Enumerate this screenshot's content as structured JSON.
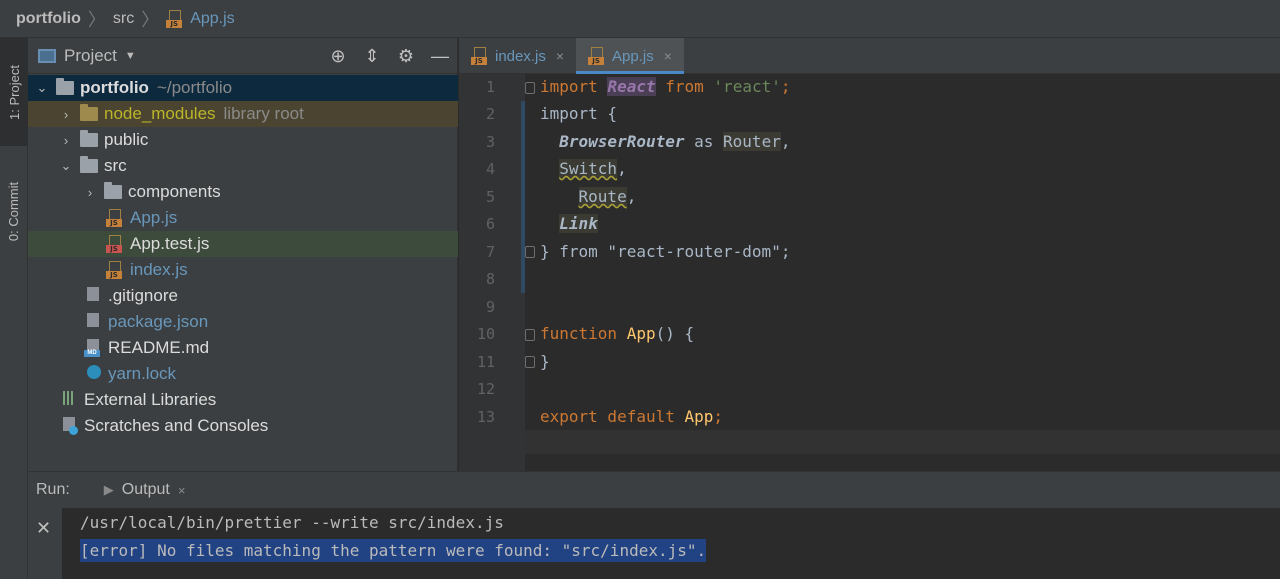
{
  "breadcrumb": {
    "project": "portfolio",
    "folder": "src",
    "file": "App.js"
  },
  "toolstrip": {
    "project_tab": "1: Project",
    "commit_tab": "0: Commit"
  },
  "project_panel": {
    "title": "Project",
    "tree": [
      {
        "label": "portfolio",
        "hint": "~/portfolio"
      },
      {
        "label": "node_modules",
        "hint": "library root"
      },
      {
        "label": "public"
      },
      {
        "label": "src"
      },
      {
        "label": "components"
      },
      {
        "label": "App.js"
      },
      {
        "label": "App.test.js"
      },
      {
        "label": "index.js"
      },
      {
        "label": ".gitignore"
      },
      {
        "label": "package.json"
      },
      {
        "label": "README.md"
      },
      {
        "label": "yarn.lock"
      },
      {
        "label": "External Libraries"
      },
      {
        "label": "Scratches and Consoles"
      }
    ]
  },
  "editor": {
    "tabs": [
      {
        "label": "index.js",
        "close": "×"
      },
      {
        "label": "App.js",
        "close": "×"
      }
    ],
    "line_numbers": [
      "1",
      "2",
      "3",
      "4",
      "5",
      "6",
      "7",
      "8",
      "9",
      "10",
      "11",
      "12",
      "13"
    ],
    "lines": {
      "l1": {
        "kw": "import",
        "react": "React",
        "from": "from",
        "str": "'react'",
        "semi": ";"
      },
      "l2": {
        "kw": "import",
        "rest": " {"
      },
      "l3": {
        "name": "BrowserRouter",
        "as": " as ",
        "alias": "Router",
        "comma": ","
      },
      "l4": {
        "name": "Switch",
        "comma": ","
      },
      "l5": {
        "name": "Route",
        "comma": ","
      },
      "l6": {
        "name": "Link"
      },
      "l7": {
        "brace": "} ",
        "from": "from",
        "str": " \"react-router-dom\"",
        "semi": ";"
      },
      "l10": {
        "kw": "function",
        "name": "App",
        "rest": "() {"
      },
      "l11": {
        "brace": "}"
      },
      "l13": {
        "kw": "export default",
        "name": "App",
        "semi": ";"
      }
    }
  },
  "run_panel": {
    "label": "Run:",
    "tab": "Output",
    "tab_close": "×",
    "close": "✕",
    "output": [
      "/usr/local/bin/prettier --write src/index.js",
      "[error] No files matching the pattern were found: \"src/index.js\"."
    ]
  }
}
